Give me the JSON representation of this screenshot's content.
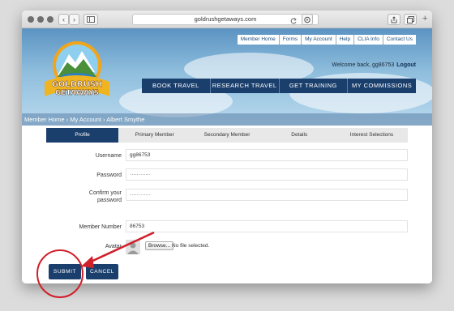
{
  "browser": {
    "url": "goldrushgetaways.com",
    "back_glyph": "‹",
    "forward_glyph": "›",
    "plus_glyph": "+"
  },
  "logo": {
    "line1": "GOLDRUSH",
    "line2": "GETAWAYS"
  },
  "top_links": [
    "Member Home",
    "Forms",
    "My Account",
    "Help",
    "CLIA Info",
    "Contact Us"
  ],
  "welcome": {
    "text": "Welcome back, gg86753",
    "logout": "Logout"
  },
  "main_nav": [
    "BOOK TRAVEL",
    "RESEARCH TRAVEL",
    "GET TRAINING",
    "MY COMMISSIONS"
  ],
  "breadcrumb": "Member Home › My Account › Albert Smythe",
  "tabs": [
    "Profile",
    "Primary Member",
    "Secondary Member",
    "Details",
    "Interest Selections"
  ],
  "form": {
    "username_label": "Username",
    "username_value": "gg86753",
    "password_label": "Password",
    "password_value": "············",
    "confirm_label_1": "Confirm your",
    "confirm_label_2": "password",
    "confirm_value": "············",
    "member_number_label": "Member Number",
    "member_number_value": "86753",
    "avatar_label": "Avatar",
    "browse_label": "Browse...",
    "no_file_text": "No file selected."
  },
  "buttons": {
    "submit": "SUBMIT",
    "cancel": "CANCEL"
  },
  "colors": {
    "nav_blue": "#1b3f6d",
    "annotation_red": "#d0202a"
  }
}
